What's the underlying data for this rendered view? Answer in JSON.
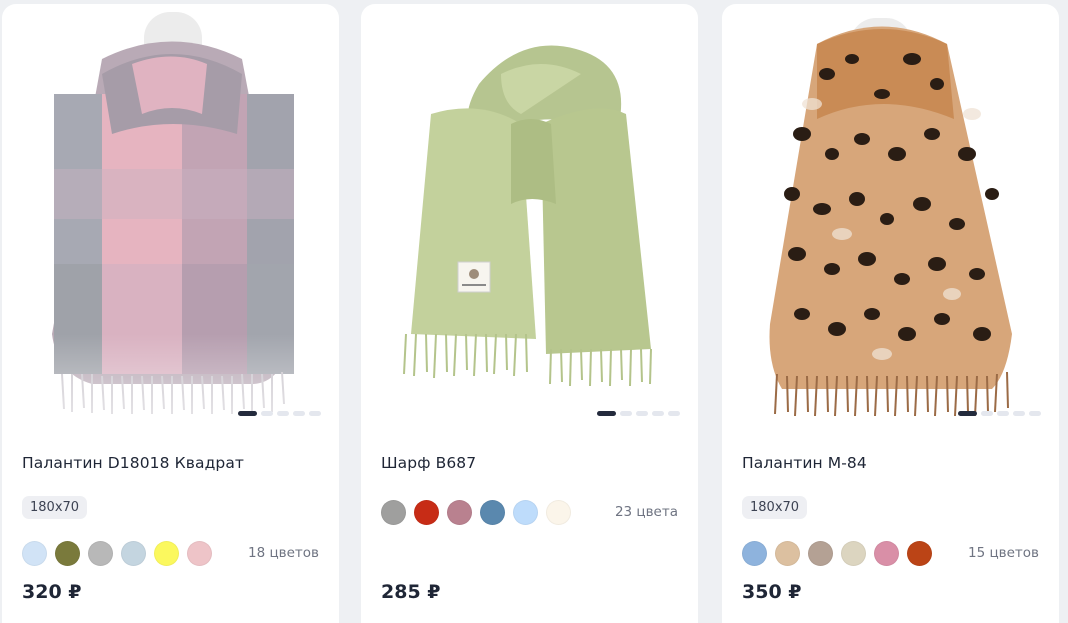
{
  "products": [
    {
      "title": "Палантин D18018 Квадрат",
      "size": "180x70",
      "swatches": [
        "#d1e3f6",
        "#7a7a3c",
        "#b8b8b8",
        "#c4d5e0",
        "#fbf85e",
        "#eec4c8"
      ],
      "colors_count": "18 цветов",
      "price": "320 ₽",
      "slides": 5,
      "active_slide": 1
    },
    {
      "title": "Шарф B687",
      "size": "",
      "swatches": [
        "#9f9f9e",
        "#c72c16",
        "#b9818f",
        "#5a88ae",
        "#bedcfb",
        "#fbf5ea"
      ],
      "colors_count": "23 цвета",
      "price": "285 ₽",
      "slides": 5,
      "active_slide": 1
    },
    {
      "title": "Палантин M-84",
      "size": "180x70",
      "swatches": [
        "#8eb3dd",
        "#dcc0a0",
        "#b4a194",
        "#dcd5c0",
        "#d98fa7",
        "#bb4416"
      ],
      "colors_count": "15 цветов",
      "price": "350 ₽",
      "slides": 5,
      "active_slide": 1
    }
  ]
}
